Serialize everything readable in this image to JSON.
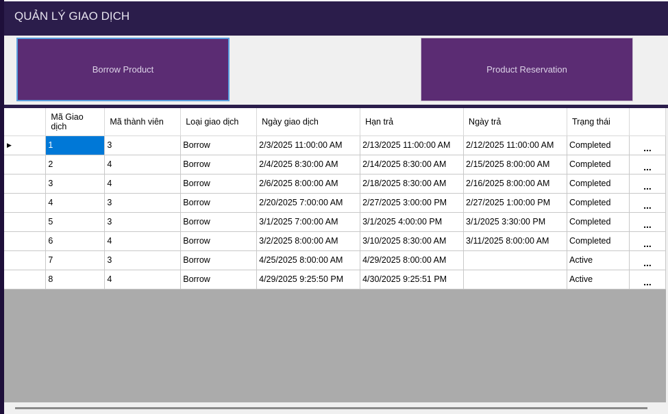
{
  "title": "QUẢN LÝ GIAO DỊCH",
  "buttons": {
    "borrow": "Borrow Product",
    "reservation": "Product Reservation"
  },
  "columns": [
    "Mã Giao dịch",
    "Mã thành viên",
    "Loại giao dịch",
    "Ngày giao dịch",
    "Hạn trả",
    "Ngày trả",
    "Trạng thái",
    ""
  ],
  "more_label": "...",
  "rows": [
    {
      "id": "1",
      "member": "3",
      "type": "Borrow",
      "date": "2/3/2025 11:00:00 AM",
      "due": "2/13/2025 11:00:00 AM",
      "returned": "2/12/2025 11:00:00 AM",
      "status": "Completed"
    },
    {
      "id": "2",
      "member": "4",
      "type": "Borrow",
      "date": "2/4/2025 8:30:00 AM",
      "due": "2/14/2025 8:30:00 AM",
      "returned": "2/15/2025 8:00:00 AM",
      "status": "Completed"
    },
    {
      "id": "3",
      "member": "4",
      "type": "Borrow",
      "date": "2/6/2025 8:00:00 AM",
      "due": "2/18/2025 8:30:00 AM",
      "returned": "2/16/2025 8:00:00 AM",
      "status": "Completed"
    },
    {
      "id": "4",
      "member": "3",
      "type": "Borrow",
      "date": "2/20/2025 7:00:00 AM",
      "due": "2/27/2025 3:00:00 PM",
      "returned": "2/27/2025 1:00:00 PM",
      "status": "Completed"
    },
    {
      "id": "5",
      "member": "3",
      "type": "Borrow",
      "date": "3/1/2025 7:00:00 AM",
      "due": "3/1/2025 4:00:00 PM",
      "returned": "3/1/2025 3:30:00 PM",
      "status": "Completed"
    },
    {
      "id": "6",
      "member": "4",
      "type": "Borrow",
      "date": "3/2/2025 8:00:00 AM",
      "due": "3/10/2025 8:30:00 AM",
      "returned": "3/11/2025 8:00:00 AM",
      "status": "Completed"
    },
    {
      "id": "7",
      "member": "3",
      "type": "Borrow",
      "date": "4/25/2025 8:00:00 AM",
      "due": "4/29/2025 8:00:00 AM",
      "returned": "",
      "status": "Active"
    },
    {
      "id": "8",
      "member": "4",
      "type": "Borrow",
      "date": "4/29/2025 9:25:50 PM",
      "due": "4/30/2025 9:25:51 PM",
      "returned": "",
      "status": "Active"
    }
  ]
}
